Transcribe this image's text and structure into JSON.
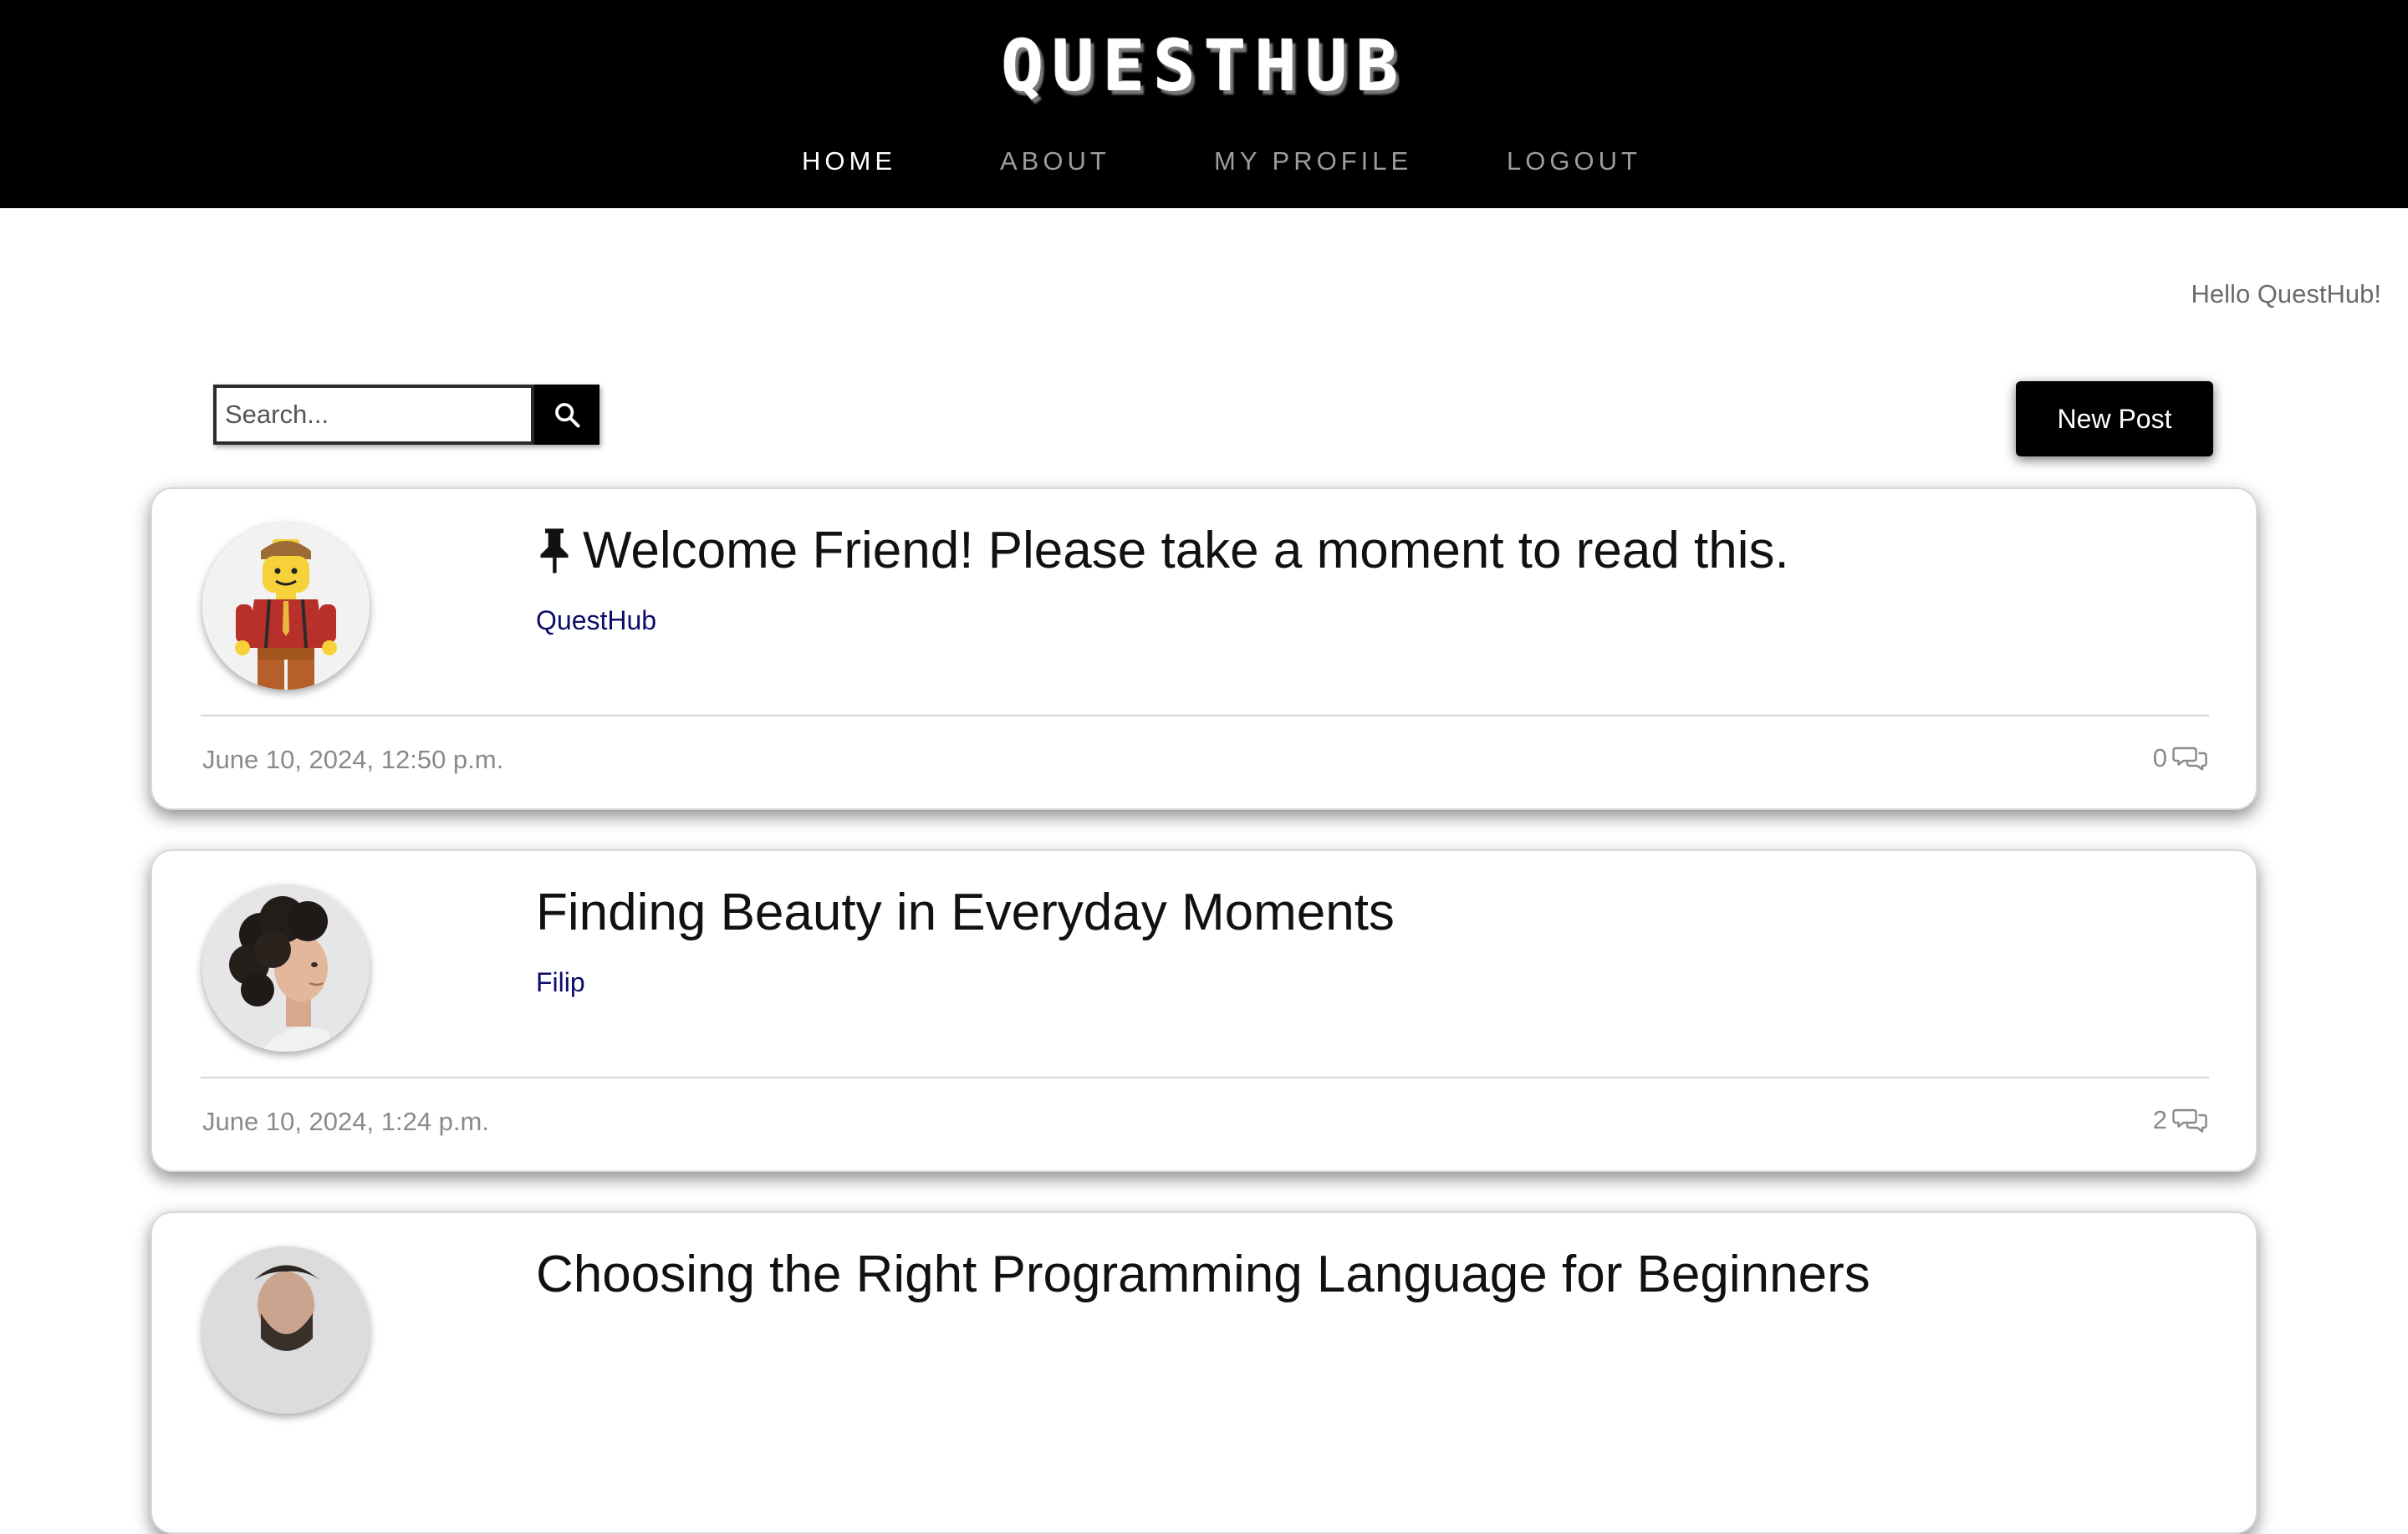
{
  "header": {
    "brand": "QUESTHUB",
    "nav": [
      {
        "label": "HOME",
        "active": true
      },
      {
        "label": "ABOUT",
        "active": false
      },
      {
        "label": "MY PROFILE",
        "active": false
      },
      {
        "label": "LOGOUT",
        "active": false
      }
    ]
  },
  "greeting": "Hello QuestHub!",
  "search": {
    "placeholder": "Search...",
    "value": "",
    "button_icon": "search-icon"
  },
  "new_post_label": "New Post",
  "posts": [
    {
      "title": "Welcome Friend! Please take a moment to read this.",
      "pinned": true,
      "author": "QuestHub",
      "date": "June 10, 2024, 12:50 p.m.",
      "comments": "0",
      "avatar": "lego-figure-avatar"
    },
    {
      "title": "Finding Beauty in Everyday Moments",
      "pinned": false,
      "author": "Filip",
      "date": "June 10, 2024, 1:24 p.m.",
      "comments": "2",
      "avatar": "curly-hair-man-avatar"
    },
    {
      "title": "Choosing the Right Programming Language for Beginners",
      "pinned": false,
      "avatar": "bearded-man-avatar"
    }
  ],
  "colors": {
    "header_bg": "#000000",
    "nav_active": "#ffffff",
    "nav_inactive": "#9d9d9d",
    "author_link": "#0c0c6b",
    "muted_text": "#8a8a8a"
  }
}
